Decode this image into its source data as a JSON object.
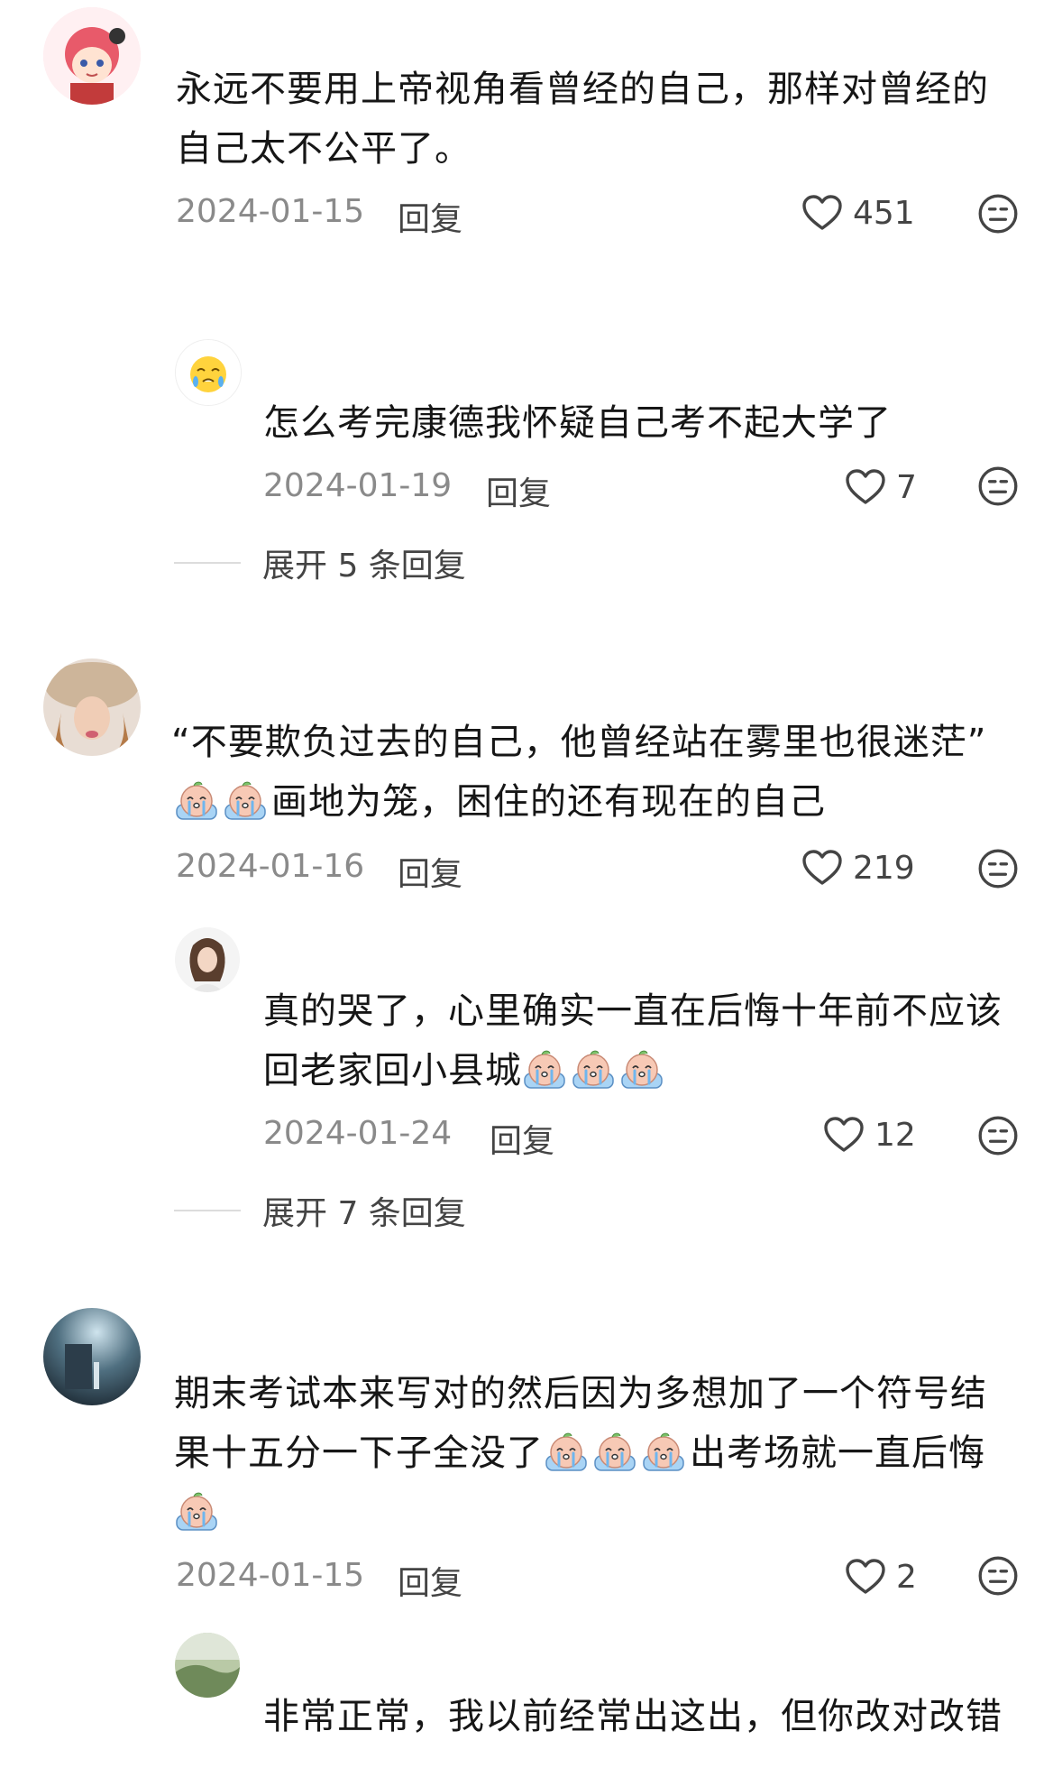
{
  "comments": [
    {
      "lines": [
        "永远不要用上帝视角看曾经的自己，那样对曾经的",
        "自己太不公平了。"
      ],
      "date": "2024-01-15",
      "reply_label": "回复",
      "likes": "451",
      "reply": {
        "lines": [
          "怎么考完康德我怀疑自己考不起大学了"
        ],
        "date": "2024-01-19",
        "reply_label": "回复",
        "likes": "7"
      },
      "expand_label": "展开 5 条回复"
    },
    {
      "lines": [
        "“不要欺负过去的自己，他曾经站在雾里也很迷茫”",
        "画地为笼，困住的还有现在的自己"
      ],
      "date": "2024-01-16",
      "reply_label": "回复",
      "likes": "219",
      "reply": {
        "lines": [
          "真的哭了，心里确实一直在后悔十年前不应该",
          "回老家回小县城"
        ],
        "date": "2024-01-24",
        "reply_label": "回复",
        "likes": "12"
      },
      "expand_label": "展开 7 条回复"
    },
    {
      "lines": [
        "期末考试本来写对的然后因为多想加了一个符号结",
        "果十五分一下子全没了",
        "出考场就一直后悔"
      ],
      "date": "2024-01-15",
      "reply_label": "回复",
      "likes": "2",
      "reply": {
        "lines": [
          "非常正常，我以前经常出这出，但你改对改错"
        ]
      }
    }
  ],
  "icons": {
    "like": "heart-outline-icon",
    "dislike": "meh-face-icon",
    "sticker": "crying-sticker-icon"
  },
  "colors": {
    "text": "#161616",
    "meta": "#8a8a8a",
    "divider": "#dcdcdc"
  }
}
